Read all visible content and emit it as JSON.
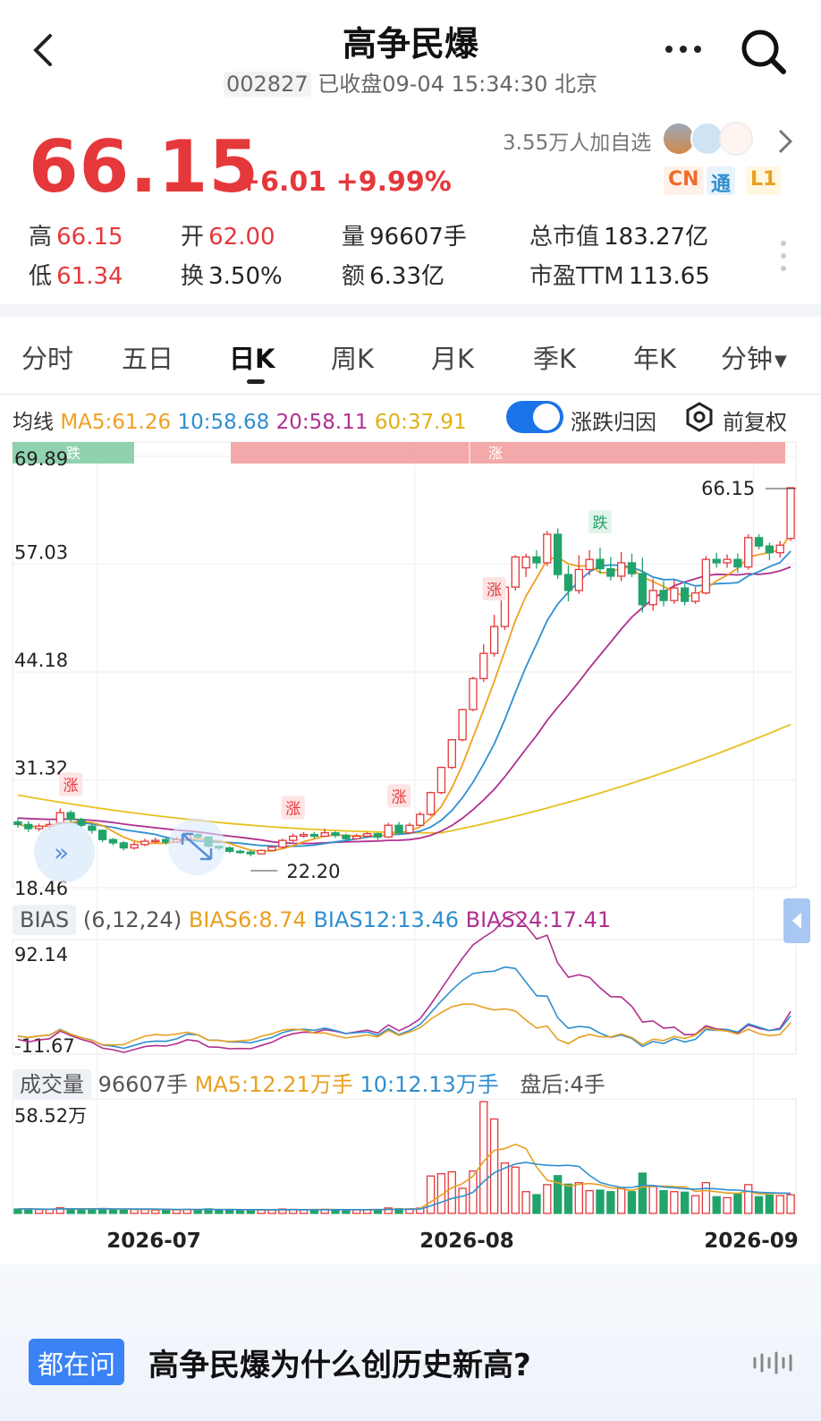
{
  "header": {
    "title": "高争民爆",
    "code": "002827",
    "status": "已收盘09-04 15:34:30 北京",
    "icons": [
      "back-arrow-icon",
      "more-icon",
      "search-icon"
    ]
  },
  "quote": {
    "price": "66.15",
    "change": "+6.01",
    "change_pct": "+9.99%",
    "watchers": "3.55万人加自选",
    "tags": [
      "CN",
      "通",
      "L1"
    ],
    "stats": [
      {
        "label": "高",
        "value": "66.15",
        "color": "red"
      },
      {
        "label": "开",
        "value": "62.00",
        "color": "red"
      },
      {
        "label": "量",
        "value": "96607手",
        "color": "dark"
      },
      {
        "label": "总市值",
        "value": "183.27亿",
        "color": "dark"
      },
      {
        "label": "低",
        "value": "61.34",
        "color": "red"
      },
      {
        "label": "换",
        "value": "3.50%",
        "color": "dark"
      },
      {
        "label": "额",
        "value": "6.33亿",
        "color": "dark"
      },
      {
        "label": "市盈TTM",
        "value": "113.65",
        "color": "dark"
      }
    ]
  },
  "tabs": [
    "分时",
    "五日",
    "日K",
    "周K",
    "月K",
    "季K",
    "年K",
    "分钟"
  ],
  "active_tab": "日K",
  "ma": {
    "label": "均线",
    "ma5": "MA5:61.26",
    "ma10": "10:58.68",
    "ma20": "20:58.11",
    "ma60": "60:37.91",
    "toggle_label": "涨跌归因",
    "toggle_on": true,
    "adjust_label": "前复权"
  },
  "colors": {
    "up": "#e5383b",
    "down": "#22a36b",
    "ma5": "#f0a020",
    "ma10": "#2f8fd0",
    "ma20": "#b0308f",
    "ma60": "#e8c020",
    "accent": "#1a73e8"
  },
  "chart_data": {
    "type": "candlestick",
    "price_axis": [
      "69.89",
      "57.03",
      "44.18",
      "31.32",
      "18.46"
    ],
    "ylim": [
      18.46,
      69.89
    ],
    "x_labels": [
      "2026-07",
      "2026-08",
      "2026-09"
    ],
    "max_label": "66.15",
    "min_label": "22.20",
    "bands": [
      {
        "label": "跌"
      },
      {
        "label": "涨"
      }
    ],
    "markers": [
      {
        "label": "涨",
        "index": 5
      },
      {
        "label": "涨",
        "index": 26
      },
      {
        "label": "涨",
        "index": 36
      },
      {
        "label": "涨",
        "index": 45
      },
      {
        "label": "跌",
        "index": 55
      }
    ],
    "candles": [
      [
        26.3,
        26.0,
        26.8,
        25.6
      ],
      [
        26.0,
        25.5,
        26.4,
        25.1
      ],
      [
        25.5,
        25.8,
        26.1,
        25.2
      ],
      [
        25.8,
        26.0,
        26.4,
        25.4
      ],
      [
        26.2,
        27.4,
        27.9,
        26.0
      ],
      [
        27.4,
        26.6,
        27.7,
        26.3
      ],
      [
        26.6,
        25.9,
        26.8,
        25.6
      ],
      [
        25.8,
        25.3,
        26.0,
        24.9
      ],
      [
        25.3,
        24.2,
        25.4,
        23.9
      ],
      [
        24.2,
        23.8,
        24.4,
        23.5
      ],
      [
        23.8,
        23.2,
        24.0,
        22.9
      ],
      [
        23.2,
        23.6,
        23.9,
        23.0
      ],
      [
        23.6,
        24.0,
        24.3,
        23.4
      ],
      [
        24.0,
        24.1,
        24.4,
        23.8
      ],
      [
        24.2,
        23.9,
        24.6,
        23.6
      ],
      [
        23.9,
        24.2,
        24.5,
        23.8
      ],
      [
        24.2,
        24.8,
        25.1,
        24.1
      ],
      [
        24.8,
        24.5,
        25.2,
        24.3
      ],
      [
        24.5,
        23.4,
        24.6,
        23.3
      ],
      [
        23.4,
        23.2,
        23.5,
        22.9
      ],
      [
        23.2,
        22.8,
        23.4,
        22.6
      ],
      [
        22.8,
        22.7,
        23.0,
        22.5
      ],
      [
        22.7,
        22.5,
        22.9,
        22.2
      ],
      [
        22.5,
        22.9,
        23.0,
        22.4
      ],
      [
        22.9,
        23.3,
        23.5,
        22.8
      ],
      [
        23.3,
        24.1,
        24.3,
        23.1
      ],
      [
        24.1,
        24.6,
        24.9,
        23.9
      ],
      [
        24.6,
        24.8,
        25.1,
        24.4
      ],
      [
        24.8,
        24.6,
        25.1,
        24.3
      ],
      [
        24.6,
        25.0,
        25.5,
        24.5
      ],
      [
        25.0,
        24.7,
        25.2,
        24.4
      ],
      [
        24.7,
        24.3,
        24.9,
        24.0
      ],
      [
        24.3,
        24.6,
        24.9,
        24.2
      ],
      [
        24.6,
        24.9,
        25.1,
        24.4
      ],
      [
        24.9,
        24.5,
        25.0,
        24.1
      ],
      [
        24.5,
        25.9,
        26.2,
        24.4
      ],
      [
        25.9,
        25.0,
        26.3,
        24.9
      ],
      [
        25.0,
        25.9,
        26.2,
        24.9
      ],
      [
        25.9,
        27.2,
        27.5,
        25.8
      ],
      [
        27.2,
        29.8,
        29.9,
        27.0
      ],
      [
        29.8,
        32.8,
        32.9,
        29.6
      ],
      [
        32.8,
        36.1,
        36.2,
        32.6
      ],
      [
        36.1,
        39.7,
        39.8,
        35.9
      ],
      [
        39.7,
        43.4,
        43.6,
        39.5
      ],
      [
        43.4,
        46.4,
        47.5,
        43.0
      ],
      [
        46.4,
        49.6,
        51.0,
        46.0
      ],
      [
        49.6,
        54.3,
        54.6,
        49.2
      ],
      [
        54.3,
        57.9,
        58.1,
        53.9
      ],
      [
        56.6,
        57.9,
        58.3,
        55.5
      ],
      [
        57.9,
        57.2,
        58.7,
        56.5
      ],
      [
        57.2,
        60.6,
        61.0,
        56.8
      ],
      [
        60.6,
        55.8,
        61.3,
        55.3
      ],
      [
        55.8,
        53.9,
        56.9,
        52.6
      ],
      [
        53.9,
        56.4,
        58.1,
        53.5
      ],
      [
        56.4,
        57.6,
        58.7,
        55.7
      ],
      [
        57.6,
        56.5,
        59.0,
        55.9
      ],
      [
        56.5,
        55.6,
        57.9,
        55.1
      ],
      [
        55.6,
        57.2,
        58.5,
        55.0
      ],
      [
        57.2,
        55.9,
        58.3,
        55.5
      ],
      [
        55.9,
        52.2,
        57.8,
        51.3
      ],
      [
        52.2,
        53.9,
        55.3,
        51.5
      ],
      [
        53.9,
        52.7,
        55.0,
        52.0
      ],
      [
        52.7,
        54.2,
        55.1,
        52.3
      ],
      [
        54.2,
        52.6,
        54.8,
        52.1
      ],
      [
        52.6,
        53.6,
        54.3,
        52.3
      ],
      [
        53.6,
        57.6,
        58.0,
        53.4
      ],
      [
        57.6,
        57.2,
        58.4,
        56.6
      ],
      [
        57.2,
        57.6,
        58.2,
        56.6
      ],
      [
        57.6,
        56.7,
        58.3,
        56.0
      ],
      [
        56.7,
        60.2,
        60.6,
        56.4
      ],
      [
        60.2,
        59.2,
        60.6,
        58.8
      ],
      [
        59.2,
        58.4,
        59.6,
        57.5
      ],
      [
        58.4,
        59.3,
        59.8,
        57.8
      ],
      [
        60.1,
        66.15,
        66.15,
        59.8
      ]
    ],
    "ma_lines": [
      {
        "name": "MA5",
        "start": [
          0,
          26.2
        ],
        "end": [
          73,
          61.26
        ]
      },
      {
        "name": "MA10",
        "end": [
          73,
          58.68
        ]
      },
      {
        "name": "MA20",
        "end": [
          73,
          58.11
        ]
      },
      {
        "name": "MA60",
        "start": [
          0,
          29.5
        ],
        "min": [
          40,
          25.0
        ],
        "end": [
          73,
          37.91
        ]
      }
    ],
    "bias": {
      "label": "BIAS",
      "params": "(6,12,24)",
      "bias6": "BIAS6:8.74",
      "bias12": "BIAS12:13.46",
      "bias24": "BIAS24:17.41",
      "axis": [
        "92.14",
        "-11.67"
      ],
      "ylim": [
        -11.67,
        92.14
      ]
    },
    "volume": {
      "label": "成交量",
      "value": "96607手",
      "ma5": "MA5:12.21万手",
      "ma10": "10:12.13万手",
      "after_hours": "盘后:4手",
      "axis_max": "58.52万",
      "ymax": 58.52
    }
  },
  "footer": {
    "badge": "都在问",
    "question": "高争民爆为什么创历史新高?"
  }
}
